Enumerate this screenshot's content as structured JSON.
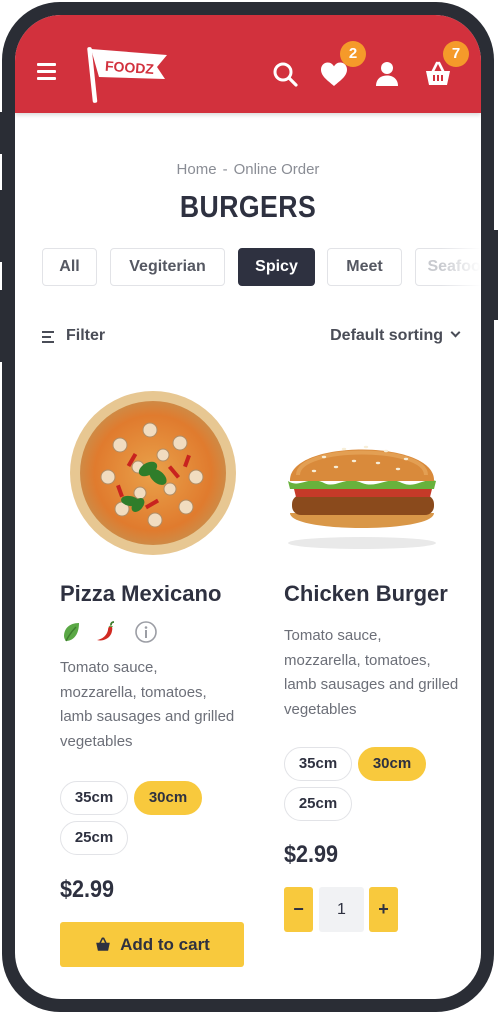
{
  "header": {
    "logo_text": "FOODZ",
    "wishlist_count": "2",
    "cart_count": "7"
  },
  "breadcrumb": {
    "home": "Home",
    "separator": "-",
    "current": "Online Order"
  },
  "page_title": "BURGERS",
  "tabs": [
    {
      "label": "All"
    },
    {
      "label": "Vegiterian"
    },
    {
      "label": "Spicy",
      "active": true
    },
    {
      "label": "Meet"
    },
    {
      "label": "Seafood"
    }
  ],
  "filter": {
    "label": "Filter"
  },
  "sorting": {
    "label": "Default sorting"
  },
  "products": [
    {
      "name": "Pizza Mexicano",
      "description": "Tomato sauce, mozzarella, tomatoes, lamb sausages and grilled vegetables",
      "tags": [
        "leaf-icon",
        "chili-icon",
        "info-icon"
      ],
      "sizes": [
        "35cm",
        "30cm",
        "25cm"
      ],
      "selected_size": "30cm",
      "price": "$2.99",
      "add_to_cart_label": "Add to cart"
    },
    {
      "name": "Chicken Burger",
      "description": "Tomato sauce, mozzarella, tomatoes, lamb sausages and grilled vegetables",
      "sizes": [
        "35cm",
        "30cm",
        "25cm"
      ],
      "selected_size": "30cm",
      "price": "$2.99",
      "quantity": "1",
      "decrement_label": "−",
      "increment_label": "+"
    }
  ],
  "colors": {
    "header_red": "#d2313d",
    "accent_yellow": "#f8c93d",
    "badge_orange": "#f59a2a",
    "dark": "#2e3140"
  }
}
